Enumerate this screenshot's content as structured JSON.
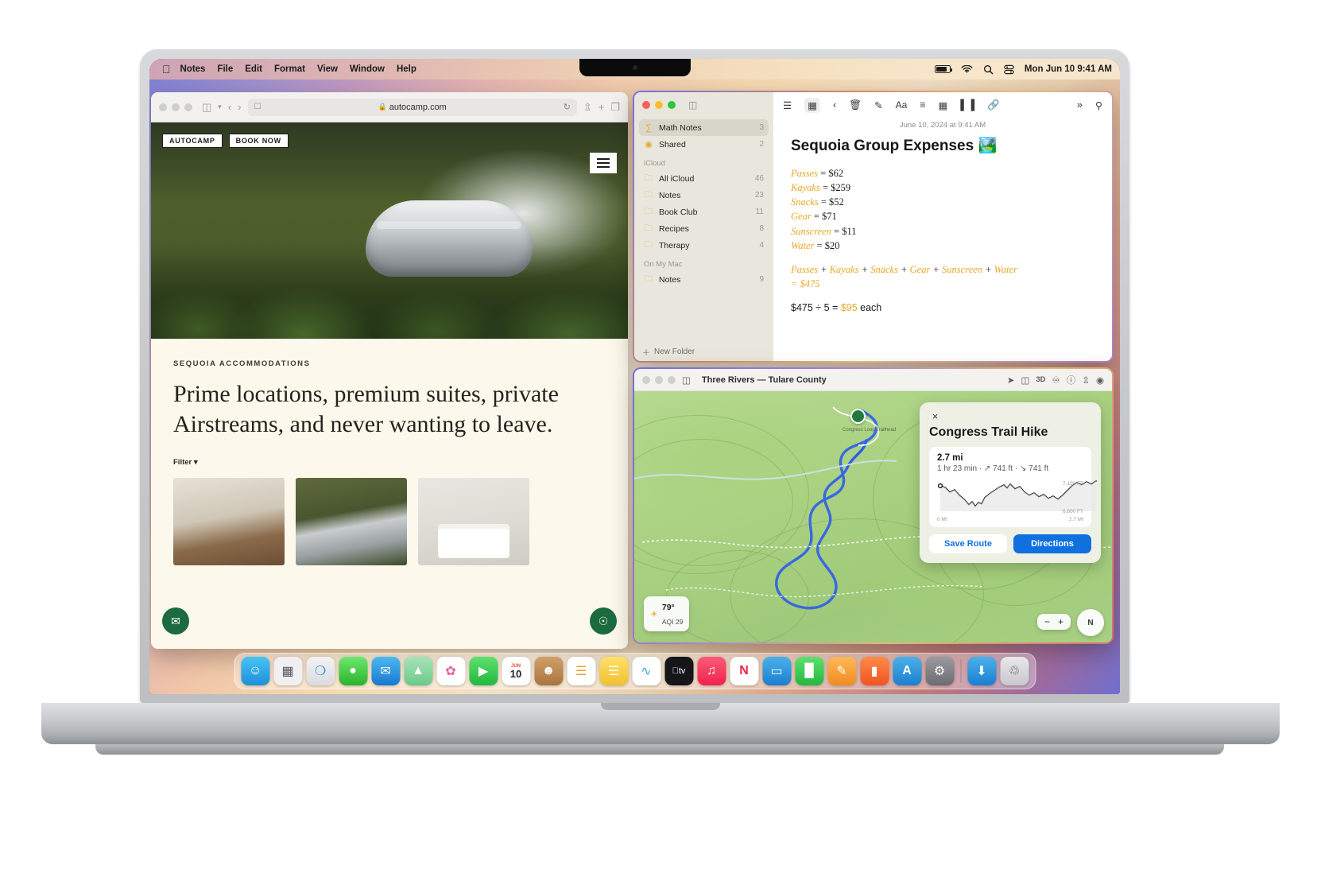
{
  "menubar": {
    "apple": "",
    "items": [
      "Notes",
      "File",
      "Edit",
      "Format",
      "View",
      "Window",
      "Help"
    ],
    "clock": "Mon Jun 10 9:41 AM",
    "icons": [
      "battery-icon",
      "wifi-icon",
      "search-icon",
      "control-center-icon"
    ]
  },
  "safari": {
    "url": "autocamp.com",
    "lock": "ὑ2",
    "reload": "↻",
    "brand": "AUTOCAMP",
    "cta": "BOOK NOW",
    "eyebrow": "SEQUOIA ACCOMMODATIONS",
    "headline": "Prime locations, premium suites, private Airstreams, and never wanting to leave.",
    "filter": "Filter",
    "cards": [
      "interior-bathroom",
      "airstream-exterior",
      "bedroom-interior"
    ]
  },
  "notes": {
    "sidebar": {
      "pinned": [
        {
          "label": "Math Notes",
          "count": "3",
          "icon": "math-icon",
          "selected": true
        },
        {
          "label": "Shared",
          "count": "2",
          "icon": "shared-icon",
          "selected": false
        }
      ],
      "sections": [
        {
          "header": "iCloud",
          "items": [
            {
              "label": "All iCloud",
              "count": "46"
            },
            {
              "label": "Notes",
              "count": "23"
            },
            {
              "label": "Book Club",
              "count": "11"
            },
            {
              "label": "Recipes",
              "count": "8"
            },
            {
              "label": "Therapy",
              "count": "4"
            }
          ]
        },
        {
          "header": "On My Mac",
          "items": [
            {
              "label": "Notes",
              "count": "9"
            }
          ]
        }
      ],
      "new_folder": "New Folder"
    },
    "toolbar": [
      "list-view-icon",
      "grid-view-icon",
      "back-icon",
      "trash-icon",
      "compose-icon",
      "format-icon",
      "checklist-icon",
      "table-icon",
      "audio-icon",
      "link-icon",
      "more-icon",
      "search-icon"
    ],
    "note": {
      "date": "June 10, 2024 at 9:41 AM",
      "title": "Sequoia Group Expenses 🏞️",
      "items": [
        {
          "name": "Passes",
          "value": "= $62"
        },
        {
          "name": "Kayaks",
          "value": "= $259"
        },
        {
          "name": "Snacks",
          "value": "= $52"
        },
        {
          "name": "Gear",
          "value": "= $71"
        },
        {
          "name": "Sunscreen",
          "value": "= $11"
        },
        {
          "name": "Water",
          "value": "= $20"
        }
      ],
      "sum_tokens": [
        "Passes",
        "Kayaks",
        "Snacks",
        "Gear",
        "Sunscreen",
        "Water"
      ],
      "sum_result": "= $475",
      "division_line_prefix": "$475 ÷ 5 = ",
      "division_result": "$95",
      "division_suffix": " each"
    }
  },
  "maps": {
    "title": "Three Rivers — Tulare County",
    "toolbar": [
      "locate-icon",
      "map-mode-icon",
      "3d-icon",
      "binoculars-icon",
      "info-icon",
      "share-icon",
      "account-icon"
    ],
    "toolbar_labels": {
      "three_d": "3D"
    },
    "card": {
      "close": "×",
      "title": "Congress Trail Hike",
      "distance": "2.7 mi",
      "details": "1 hr 23 min · ↗ 741 ft · ↘ 741 ft",
      "elev_high": "7,100 FT",
      "elev_low": "6,800 FT",
      "axis_start": "0 MI",
      "axis_end": "2.7 MI",
      "save_button": "Save Route",
      "directions_button": "Directions"
    },
    "weather": {
      "temp": "79°",
      "aqi": "AQI 29",
      "icon": "sun-icon"
    },
    "zoom_controls": {
      "out": "−",
      "in": "+"
    },
    "compass": "N",
    "trail_label": "Congress Loop Trailhead"
  },
  "dock": {
    "items": [
      {
        "name": "finder",
        "glyph": "☺",
        "color": "#2a8fe0"
      },
      {
        "name": "launchpad",
        "glyph": "▒",
        "color": "#e8e8ea"
      },
      {
        "name": "safari",
        "glyph": "◉",
        "color": "#2fa3e8"
      },
      {
        "name": "messages",
        "glyph": "●",
        "color": "#4cd137"
      },
      {
        "name": "mail",
        "glyph": "✉",
        "color": "#2a8fe0"
      },
      {
        "name": "maps",
        "glyph": "▲",
        "color": "#7ed0a0"
      },
      {
        "name": "photos",
        "glyph": "✿",
        "color": "#ffffff"
      },
      {
        "name": "facetime",
        "glyph": "▶",
        "color": "#3ec75c"
      },
      {
        "name": "calendar",
        "glyph": "10",
        "color": "#ffffff",
        "badge": "JUN"
      },
      {
        "name": "contacts",
        "glyph": "☻",
        "color": "#c08a4a"
      },
      {
        "name": "reminders",
        "glyph": "☰",
        "color": "#ffffff"
      },
      {
        "name": "notes",
        "glyph": "☰",
        "color": "#ffd95e"
      },
      {
        "name": "freeform",
        "glyph": "∿",
        "color": "#ffffff"
      },
      {
        "name": "tv",
        "glyph": "",
        "color": "#1c1c1e"
      },
      {
        "name": "music",
        "glyph": "♫",
        "color": "#fb3b5c"
      },
      {
        "name": "news",
        "glyph": "N",
        "color": "#ffffff"
      },
      {
        "name": "keynote",
        "glyph": "▭",
        "color": "#2a8fe0"
      },
      {
        "name": "numbers",
        "glyph": "▐",
        "color": "#3ec75c"
      },
      {
        "name": "pages",
        "glyph": "✎",
        "color": "#f2a33c"
      },
      {
        "name": "books",
        "glyph": "▮",
        "color": "#f2622a"
      },
      {
        "name": "app-store",
        "glyph": "A",
        "color": "#2a8fe0"
      },
      {
        "name": "system-settings",
        "glyph": "⚙",
        "color": "#8e8e93"
      },
      {
        "name": "downloads",
        "glyph": "⬇",
        "color": "#2a8fe0"
      },
      {
        "name": "trash",
        "glyph": "Ὕ1",
        "color": "#d8d8dc"
      }
    ]
  }
}
